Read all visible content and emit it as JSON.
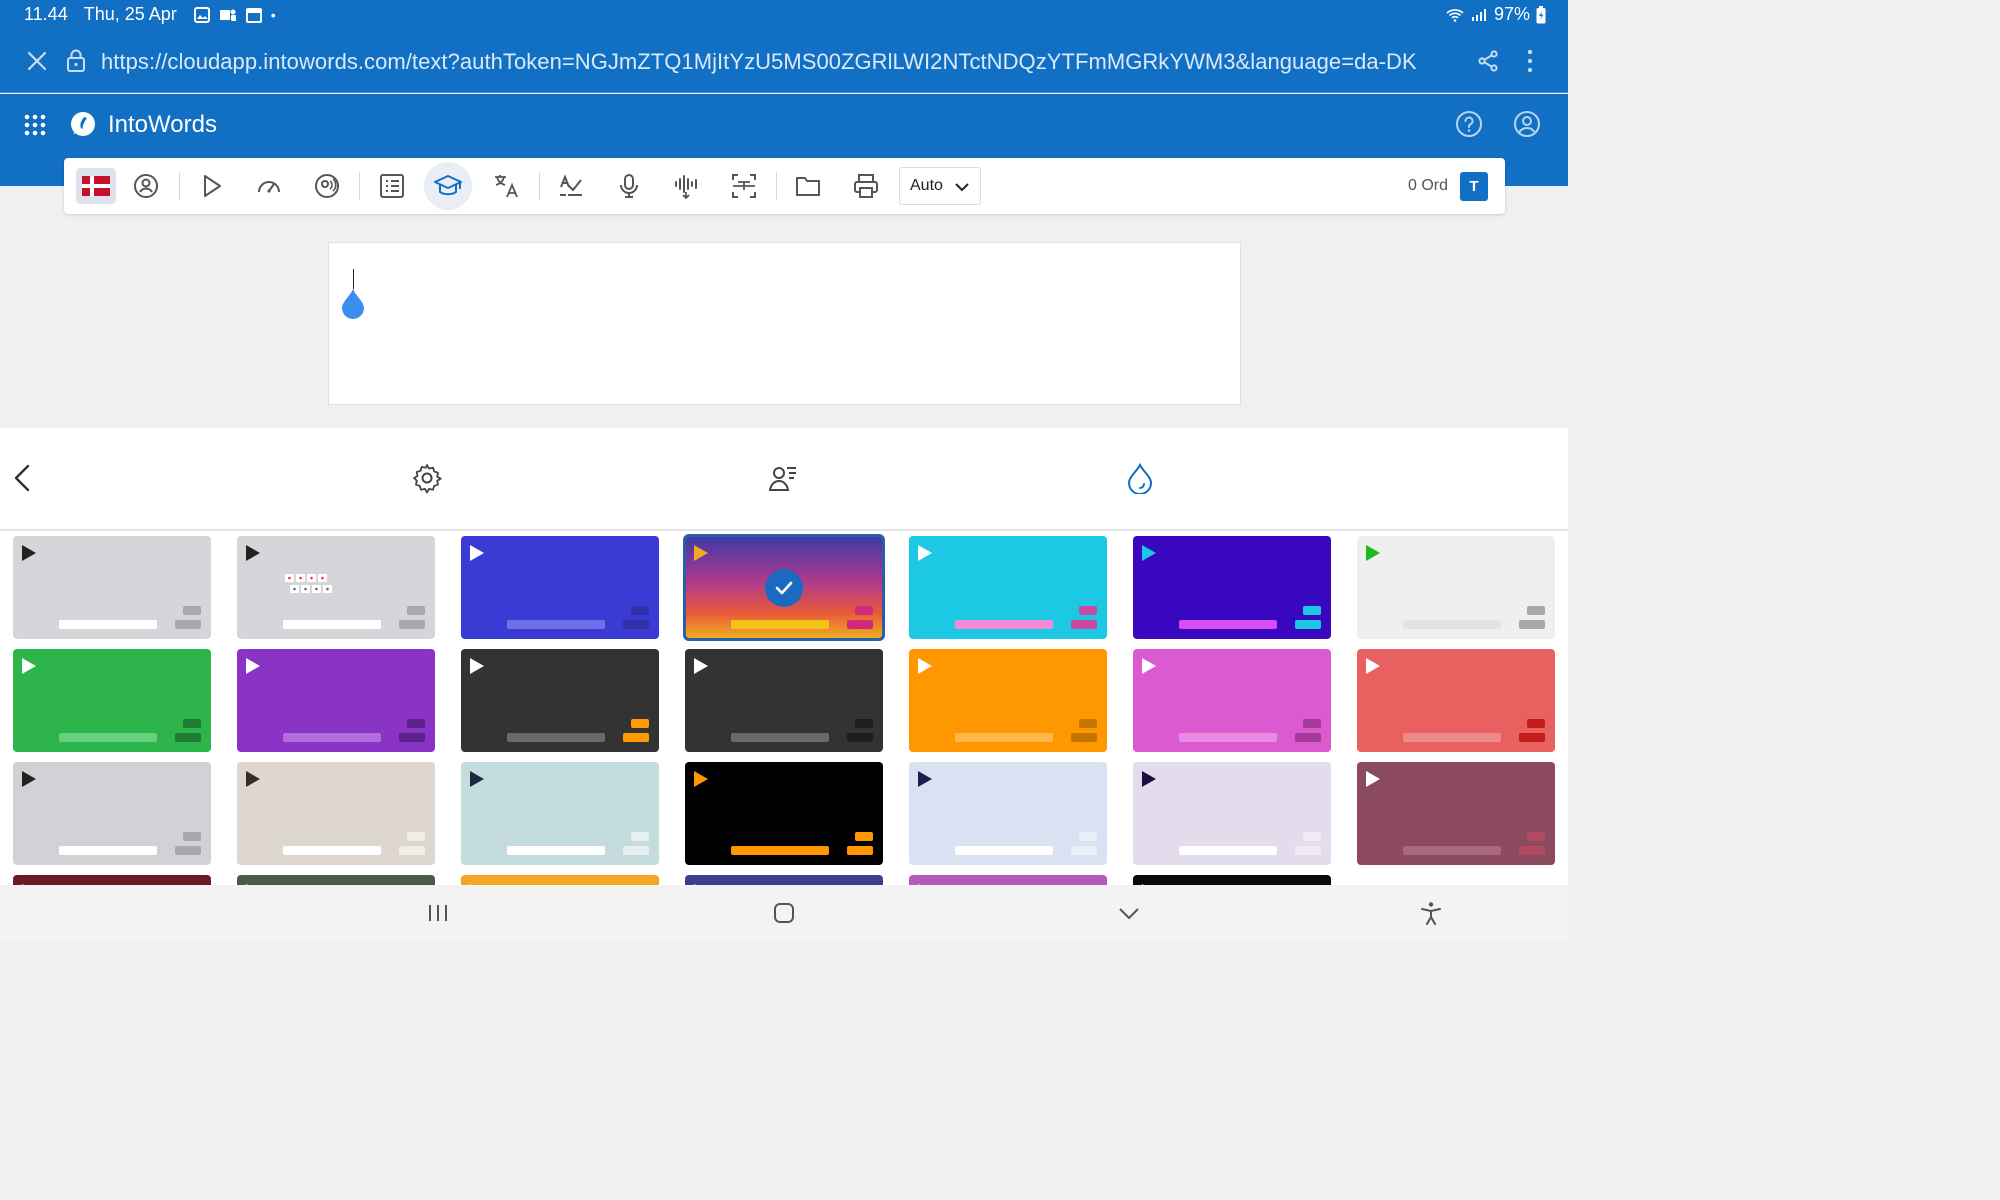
{
  "status": {
    "time": "11.44",
    "date": "Thu, 25 Apr",
    "battery": "97%"
  },
  "browser": {
    "url": "https://cloudapp.intowords.com/text?authToken=NGJmZTQ1MjItYzU5MS00ZGRlLWI2NTctNDQzYTFmMGRkYWM3&language=da-DK"
  },
  "app": {
    "title": "IntoWords"
  },
  "toolbar": {
    "language_flag": "Danish flag",
    "voice_mode": "Auto",
    "word_count": "0 Ord",
    "badge": "T"
  },
  "colors": {
    "primary": "#1170c4",
    "selected": "#2a5dab"
  },
  "themes": [
    {
      "name": "gray",
      "bg": "#d5d6d9",
      "play": "#222",
      "bar": "#ffffff",
      "s1": "#a8a9ad",
      "s2": "#a8a9ad"
    },
    {
      "name": "gray-pattern",
      "bg": "#d5d6d9",
      "play": "#222",
      "bar": "#ffffff",
      "s1": "#a8a9ad",
      "s2": "#a8a9ad"
    },
    {
      "name": "blue",
      "bg": "#3a3ad4",
      "play": "#ffffff",
      "bar": "#6f70e8",
      "s1": "#3030a8",
      "s2": "#3030a8"
    },
    {
      "name": "sunset",
      "bg": "linear-gradient(180deg,#3d3aa8 0%,#b03a8a 45%,#e85a3a 75%,#f0b020 100%)",
      "play": "#f5a623",
      "bar": "#f5c21a",
      "s1": "#d12a7a",
      "s2": "#d12a7a"
    },
    {
      "name": "cyan",
      "bg": "#1dc8e4",
      "play": "#ffffff",
      "bar": "#f38ad8",
      "s1": "#c74aa0",
      "s2": "#c74aa0"
    },
    {
      "name": "indigo",
      "bg": "#3a07c0",
      "play": "#1dc8e4",
      "bar": "#d84ef0",
      "s1": "#1dc8e4",
      "s2": "#1dc8e4"
    },
    {
      "name": "light",
      "bg": "#efefef",
      "play": "#1fb81f",
      "bar": "#e3e3e3",
      "s1": "#a8a8a8",
      "s2": "#a8a8a8"
    },
    {
      "name": "green",
      "bg": "#2db44a",
      "play": "#ffffff",
      "bar": "#66d07f",
      "s1": "#1f7a33",
      "s2": "#1f7a33"
    },
    {
      "name": "purple",
      "bg": "#8a34c6",
      "play": "#ffffff",
      "bar": "#b06ede",
      "s1": "#5c2288",
      "s2": "#5c2288"
    },
    {
      "name": "dark-orange",
      "bg": "#333333",
      "play": "#ffffff",
      "bar": "#6a6a6a",
      "s1": "#ff9a00",
      "s2": "#ff9a00"
    },
    {
      "name": "dark",
      "bg": "#333333",
      "play": "#ffffff",
      "bar": "#6a6a6a",
      "s1": "#1e1e1e",
      "s2": "#1e1e1e"
    },
    {
      "name": "orange",
      "bg": "#ff9800",
      "play": "#ffffff",
      "bar": "#ffb64a",
      "s1": "#c47500",
      "s2": "#c47500"
    },
    {
      "name": "pink",
      "bg": "#dc5ad0",
      "play": "#ffffff",
      "bar": "#e88be0",
      "s1": "#a33a98",
      "s2": "#a33a98"
    },
    {
      "name": "coral",
      "bg": "#e86060",
      "play": "#ffffff",
      "bar": "#ef8a8a",
      "s1": "#c41a1a",
      "s2": "#c41a1a"
    },
    {
      "name": "silver",
      "bg": "#d0d2d6",
      "play": "#222",
      "bar": "#ffffff",
      "s1": "#a6a8ac",
      "s2": "#a6a8ac"
    },
    {
      "name": "beige",
      "bg": "#ddd7d0",
      "play": "#3a2a20",
      "bar": "#ffffff",
      "s1": "#f0ece7",
      "s2": "#f0ece7"
    },
    {
      "name": "mint",
      "bg": "#c4dcdd",
      "play": "#1a2a40",
      "bar": "#ffffff",
      "s1": "#e6f0f0",
      "s2": "#e6f0f0"
    },
    {
      "name": "black",
      "bg": "#000000",
      "play": "#ff9800",
      "bar": "#ff9800",
      "s1": "#ff9800",
      "s2": "#ff9800"
    },
    {
      "name": "powder",
      "bg": "#d8e2f2",
      "play": "#1a2050",
      "bar": "#ffffff",
      "s1": "#eaf0f8",
      "s2": "#eaf0f8"
    },
    {
      "name": "lavender",
      "bg": "#e3dced",
      "play": "#1a1040",
      "bar": "#ffffff",
      "s1": "#f0ecf6",
      "s2": "#f0ecf6"
    },
    {
      "name": "wine",
      "bg": "#8c4a5e",
      "play": "#ffffff",
      "bar": "#a66a7c",
      "s1": "#b04a60",
      "s2": "#b04a60"
    },
    {
      "name": "maroon",
      "bg": "#6a1c22",
      "play": "#ffffff",
      "bar": "#ffffff",
      "s1": "#ffffff",
      "s2": "#ffffff"
    },
    {
      "name": "olive",
      "bg": "#4c5a4a",
      "play": "#ffffff",
      "bar": "#ffffff",
      "s1": "#ffffff",
      "s2": "#ffffff"
    },
    {
      "name": "amber",
      "bg": "#f4a620",
      "play": "#ffffff",
      "bar": "#ffffff",
      "s1": "#ffffff",
      "s2": "#ffffff"
    },
    {
      "name": "navy",
      "bg": "#3d3e8e",
      "play": "#ffffff",
      "bar": "#ffffff",
      "s1": "#ffffff",
      "s2": "#ffffff"
    },
    {
      "name": "magenta",
      "bg": "#b45ab8",
      "play": "#ffffff",
      "bar": "#ffffff",
      "s1": "#ffffff",
      "s2": "#ffffff"
    },
    {
      "name": "night",
      "bg": "#0a0a0a",
      "play": "#ffffff",
      "bar": "#ffffff",
      "s1": "#ffffff",
      "s2": "#ffffff"
    },
    {
      "name": "blank",
      "bg": "#ffffff",
      "play": "#ffffff",
      "bar": "#ffffff",
      "s1": "#ffffff",
      "s2": "#ffffff"
    }
  ],
  "selected_theme": "sunset",
  "icons": {
    "close": "close-icon",
    "lock": "lock-icon",
    "share": "share-icon",
    "more": "more-vertical-icon",
    "apps": "apps-grid-icon",
    "help": "help-icon",
    "account": "account-icon"
  }
}
